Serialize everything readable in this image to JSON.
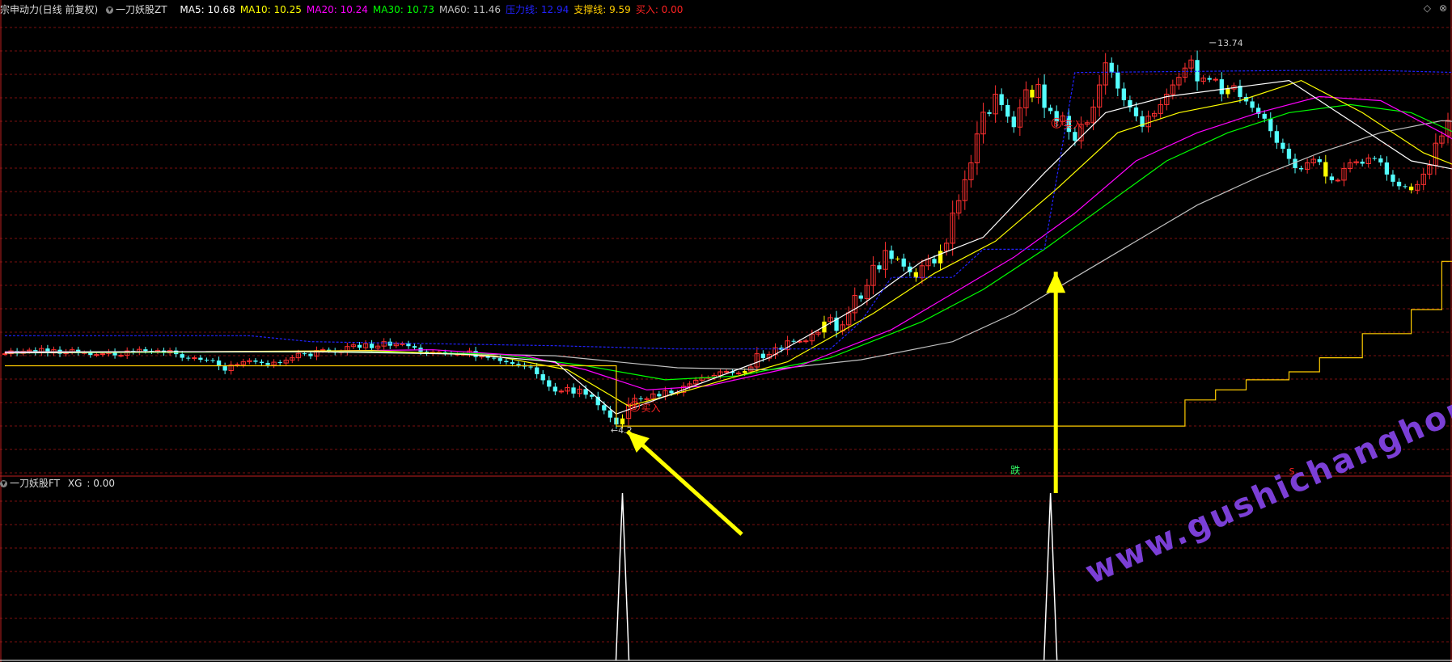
{
  "header": {
    "title": "宗申动力(日线 前复权)",
    "indicator": "一刀妖股ZT",
    "items": [
      {
        "label": "MA5",
        "value": "10.68",
        "color": "#ffffff"
      },
      {
        "label": "MA10",
        "value": "10.25",
        "color": "#ffff00"
      },
      {
        "label": "MA20",
        "value": "10.24",
        "color": "#ff00ff"
      },
      {
        "label": "MA30",
        "value": "10.73",
        "color": "#00ff00"
      },
      {
        "label": "MA60",
        "value": "11.46",
        "color": "#c0c0c0"
      },
      {
        "label": "压力线",
        "value": "12.94",
        "color": "#2222ff"
      },
      {
        "label": "支撑线",
        "value": "9.59",
        "color": "#ffcc00"
      },
      {
        "label": "买入",
        "value": "0.00",
        "color": "#ff2222"
      }
    ]
  },
  "sub_header": {
    "indicator": "一刀妖股FT",
    "label": "XG",
    "value": "0.00"
  },
  "watermark": "www.gushichanghong.com",
  "chart_data": {
    "type": "candlestick",
    "price_range": [
      3.8,
      14.2
    ],
    "annotations": {
      "high_label": "13.74",
      "low_label": "4.2",
      "buy_label": "买入",
      "buy_marker": "B",
      "drop_label": "跌",
      "s_label": "S"
    },
    "colors": {
      "up": "#ff3030",
      "down": "#54ffff",
      "signal": "#ffff00",
      "ma5": "#ffffff",
      "ma10": "#ffff00",
      "ma20": "#ff00ff",
      "ma30": "#00ff00",
      "ma60": "#c0c0c0",
      "resistance": "#2222ff",
      "support": "#ffcc00",
      "grid": "#7a1010"
    },
    "close_series": [
      6.0,
      6.07,
      6.01,
      6.06,
      6.09,
      6.03,
      6.13,
      6.02,
      6.1,
      6.0,
      6.05,
      6.1,
      6.03,
      6.03,
      5.97,
      5.98,
      6.0,
      6.05,
      5.96,
      5.96,
      6.07,
      6.04,
      6.11,
      6.07,
      6.05,
      6.08,
      6.02,
      6.08,
      5.99,
      5.9,
      5.88,
      5.9,
      5.85,
      5.84,
      5.83,
      5.69,
      5.58,
      5.72,
      5.73,
      5.8,
      5.83,
      5.8,
      5.77,
      5.72,
      5.79,
      5.77,
      5.84,
      5.9,
      6.01,
      6.0,
      5.94,
      6.08,
      6.1,
      6.08,
      6.03,
      6.05,
      6.18,
      6.22,
      6.15,
      6.25,
      6.14,
      6.19,
      6.3,
      6.2,
      6.24,
      6.25,
      6.19,
      6.15,
      6.05,
      6.01,
      6.04,
      6.04,
      6.01,
      5.99,
      5.99,
      5.99,
      6.07,
      5.92,
      5.94,
      5.9,
      5.89,
      5.82,
      5.79,
      5.75,
      5.72,
      5.68,
      5.66,
      5.49,
      5.34,
      5.18,
      5.06,
      5.07,
      5.16,
      5.01,
      5.12,
      4.98,
      4.93,
      4.72,
      4.59,
      4.41,
      4.24,
      4.39,
      4.74,
      4.89,
      4.87,
      4.88,
      5.0,
      4.94,
      5.08,
      5.02,
      5.04,
      5.19,
      5.25,
      5.34,
      5.41,
      5.41,
      5.46,
      5.55,
      5.56,
      5.52,
      5.52,
      5.57,
      5.67,
      6.0,
      5.89,
      5.98,
      6.15,
      6.1,
      6.32,
      6.31,
      6.31,
      6.32,
      6.49,
      6.53,
      6.8,
      6.9,
      6.57,
      6.72,
      7.02,
      7.45,
      7.37,
      7.7,
      8.2,
      8.1,
      8.57,
      8.36,
      8.37,
      8.17,
      8.03,
      7.89,
      8.19,
      8.36,
      8.25,
      8.56,
      8.75,
      9.5,
      9.81,
      10.33,
      10.75,
      11.47,
      12.01,
      11.97,
      12.46,
      12.19,
      11.9,
      11.64,
      12.12,
      12.57,
      12.38,
      12.7,
      12.12,
      12.04,
      11.78,
      11.92,
      11.52,
      11.3,
      11.71,
      11.75,
      12.14,
      12.69,
      13.24,
      13.0,
      12.6,
      12.31,
      12.13,
      11.91,
      11.65,
      11.91,
      11.98,
      12.2,
      12.46,
      12.69,
      12.88,
      13.11,
      13.31,
      12.78,
      12.86,
      12.82,
      12.83,
      12.46,
      12.59,
      12.67,
      12.39,
      12.28,
      12.12,
      11.97,
      11.85,
      11.54,
      11.25,
      11.1,
      10.85,
      10.62,
      10.59,
      10.75,
      10.84,
      10.77,
      10.41,
      10.32,
      10.32,
      10.61,
      10.75,
      10.78,
      10.73,
      10.87,
      10.86,
      10.76,
      10.46,
      10.28,
      10.17,
      10.16,
      10.07,
      10.21,
      10.47,
      10.69,
      11.24,
      11.42,
      11.81
    ],
    "big_up_bars": [
      101,
      121,
      134,
      146,
      149,
      153,
      168,
      200,
      216,
      230
    ],
    "ma5_points": [
      [
        0,
        6.02
      ],
      [
        25,
        6.05
      ],
      [
        50,
        6.05
      ],
      [
        75,
        5.99
      ],
      [
        90,
        5.8
      ],
      [
        100,
        4.5
      ],
      [
        110,
        5.05
      ],
      [
        125,
        5.9
      ],
      [
        140,
        7.2
      ],
      [
        150,
        8.3
      ],
      [
        160,
        8.9
      ],
      [
        170,
        10.5
      ],
      [
        180,
        12.0
      ],
      [
        190,
        12.4
      ],
      [
        200,
        12.6
      ],
      [
        210,
        12.8
      ],
      [
        220,
        11.8
      ],
      [
        230,
        10.8
      ],
      [
        240,
        10.5
      ],
      [
        252,
        11.4
      ]
    ],
    "ma10_points": [
      [
        0,
        6.02
      ],
      [
        30,
        6.05
      ],
      [
        60,
        6.08
      ],
      [
        80,
        5.95
      ],
      [
        92,
        5.6
      ],
      [
        102,
        4.7
      ],
      [
        112,
        5.1
      ],
      [
        128,
        5.8
      ],
      [
        142,
        7.0
      ],
      [
        152,
        8.0
      ],
      [
        162,
        8.8
      ],
      [
        172,
        10.1
      ],
      [
        182,
        11.5
      ],
      [
        192,
        12.0
      ],
      [
        202,
        12.3
      ],
      [
        212,
        12.8
      ],
      [
        222,
        12.0
      ],
      [
        232,
        11.0
      ],
      [
        242,
        10.4
      ],
      [
        252,
        10.3
      ]
    ],
    "ma20_points": [
      [
        0,
        6.03
      ],
      [
        40,
        6.05
      ],
      [
        70,
        6.1
      ],
      [
        85,
        5.95
      ],
      [
        95,
        5.6
      ],
      [
        105,
        5.1
      ],
      [
        115,
        5.2
      ],
      [
        130,
        5.7
      ],
      [
        145,
        6.6
      ],
      [
        155,
        7.5
      ],
      [
        165,
        8.4
      ],
      [
        175,
        9.5
      ],
      [
        185,
        10.8
      ],
      [
        195,
        11.5
      ],
      [
        205,
        12.0
      ],
      [
        215,
        12.4
      ],
      [
        225,
        12.3
      ],
      [
        235,
        11.5
      ],
      [
        245,
        10.6
      ],
      [
        252,
        10.24
      ]
    ],
    "ma30_points": [
      [
        0,
        6.02
      ],
      [
        50,
        6.05
      ],
      [
        80,
        6.0
      ],
      [
        95,
        5.7
      ],
      [
        108,
        5.35
      ],
      [
        120,
        5.45
      ],
      [
        135,
        5.9
      ],
      [
        150,
        6.8
      ],
      [
        160,
        7.6
      ],
      [
        170,
        8.6
      ],
      [
        180,
        9.7
      ],
      [
        190,
        10.8
      ],
      [
        200,
        11.5
      ],
      [
        210,
        12.0
      ],
      [
        220,
        12.2
      ],
      [
        230,
        12.0
      ],
      [
        240,
        11.3
      ],
      [
        252,
        10.73
      ]
    ],
    "ma60_points": [
      [
        0,
        6.05
      ],
      [
        60,
        6.05
      ],
      [
        90,
        5.95
      ],
      [
        110,
        5.65
      ],
      [
        125,
        5.6
      ],
      [
        140,
        5.85
      ],
      [
        155,
        6.3
      ],
      [
        165,
        7.0
      ],
      [
        175,
        7.9
      ],
      [
        185,
        8.8
      ],
      [
        195,
        9.7
      ],
      [
        205,
        10.4
      ],
      [
        215,
        11.0
      ],
      [
        225,
        11.5
      ],
      [
        235,
        11.8
      ],
      [
        245,
        11.7
      ],
      [
        252,
        11.46
      ]
    ],
    "resistance_points": [
      [
        0,
        6.45
      ],
      [
        40,
        6.45
      ],
      [
        50,
        6.3
      ],
      [
        70,
        6.25
      ],
      [
        90,
        6.2
      ],
      [
        110,
        6.12
      ],
      [
        135,
        6.12
      ],
      [
        140,
        6.8
      ],
      [
        145,
        7.9
      ],
      [
        155,
        7.9
      ],
      [
        160,
        8.6
      ],
      [
        170,
        8.6
      ],
      [
        175,
        13.0
      ],
      [
        210,
        13.05
      ],
      [
        225,
        13.05
      ],
      [
        252,
        12.94
      ]
    ],
    "support_points": [
      [
        0,
        5.7
      ],
      [
        85,
        5.7
      ],
      [
        100,
        4.2
      ],
      [
        190,
        4.2
      ],
      [
        193,
        4.85
      ],
      [
        198,
        5.1
      ],
      [
        203,
        5.35
      ],
      [
        210,
        5.55
      ],
      [
        215,
        5.9
      ],
      [
        222,
        6.5
      ],
      [
        230,
        7.1
      ],
      [
        235,
        8.3
      ],
      [
        242,
        8.6
      ],
      [
        248,
        9.59
      ],
      [
        252,
        9.59
      ]
    ],
    "buy_signals": [
      103,
      172
    ],
    "sub_chart": {
      "type": "spike",
      "spike_at": [
        101,
        171
      ],
      "label": "XG"
    }
  }
}
